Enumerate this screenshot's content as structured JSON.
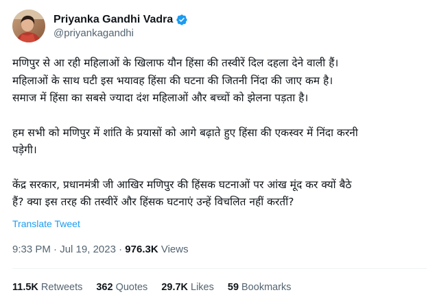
{
  "author": {
    "display_name": "Priyanka Gandhi Vadra",
    "handle": "@priyankagandhi",
    "verified_icon": "verified-badge-icon",
    "verified_color": "#1d9bf0"
  },
  "tweet": {
    "paragraphs": [
      {
        "lines": [
          "मणिपुर से आ रही महिलाओं के खिलाफ यौन हिंसा की तस्वीरें दिल दहला देने वाली हैं।",
          "महिलाओं के साथ घटी इस भयावह हिंसा की घटना की जितनी निंदा की जाए कम है।",
          "समाज में हिंसा का सबसे ज्यादा दंश महिलाओं और बच्चों को झेलना पड़ता है।"
        ]
      },
      {
        "lines": [
          "हम सभी को मणिपुर में शांति के प्रयासों को आगे बढ़ाते हुए हिंसा की एकस्वर में निंदा करनी",
          "पड़ेगी।"
        ]
      },
      {
        "lines": [
          "केंद्र सरकार, प्रधानमंत्री जी आखिर मणिपुर की हिंसक घटनाओं पर आंख मूंद कर क्यों बैठे",
          "हैं? क्या इस तरह की तस्वीरें और हिंसक घटनाएं उन्हें विचलित नहीं करतीं?"
        ]
      }
    ],
    "translate_label": "Translate Tweet",
    "time": "9:33 PM",
    "separator": "·",
    "date": "Jul 19, 2023",
    "views_count": "976.3K",
    "views_label": "Views"
  },
  "stats": {
    "retweets_count": "11.5K",
    "retweets_label": "Retweets",
    "quotes_count": "362",
    "quotes_label": "Quotes",
    "likes_count": "29.7K",
    "likes_label": "Likes",
    "bookmarks_count": "59",
    "bookmarks_label": "Bookmarks"
  },
  "colors": {
    "link": "#1d9bf0",
    "secondary_text": "#536471",
    "primary_text": "#0f1419",
    "divider": "#eff3f4"
  }
}
